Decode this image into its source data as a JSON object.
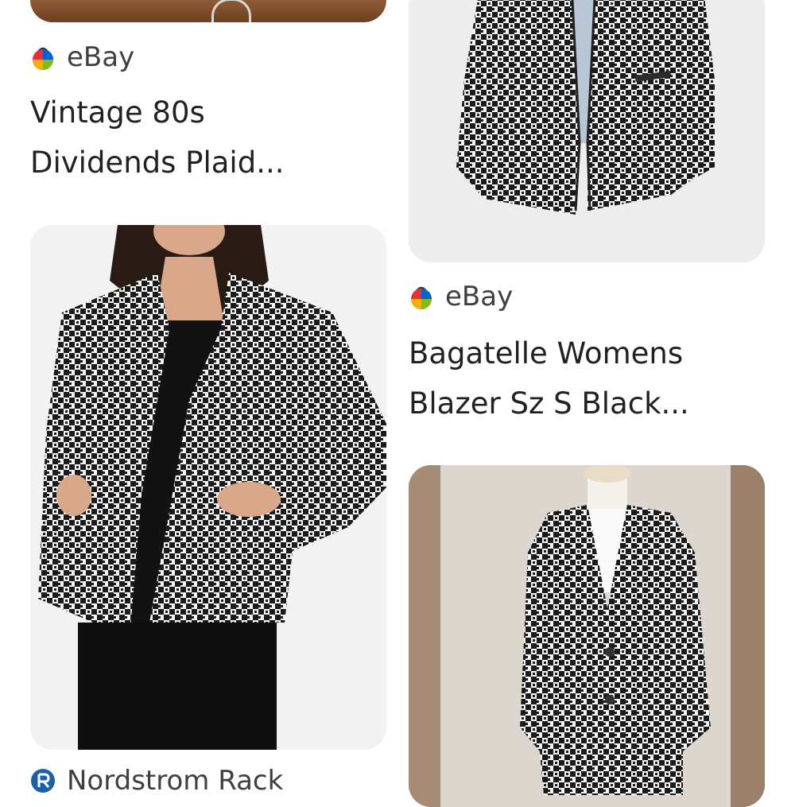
{
  "results": [
    {
      "source": "eBay",
      "title_line1": "Vintage 80s",
      "title_line2": "Dividends Plaid..."
    },
    {
      "source": "eBay",
      "title_line1": "Bagatelle Womens",
      "title_line2": "Blazer Sz S Black..."
    },
    {
      "source": "Nordstrom Rack"
    }
  ],
  "icons": {
    "ebay": "ebay-bag-icon",
    "nordstrom": "nordstrom-rack-icon"
  },
  "colors": {
    "text": "#202124",
    "source_text": "#3c4043",
    "nordstrom_blue": "#1f5fa8"
  }
}
